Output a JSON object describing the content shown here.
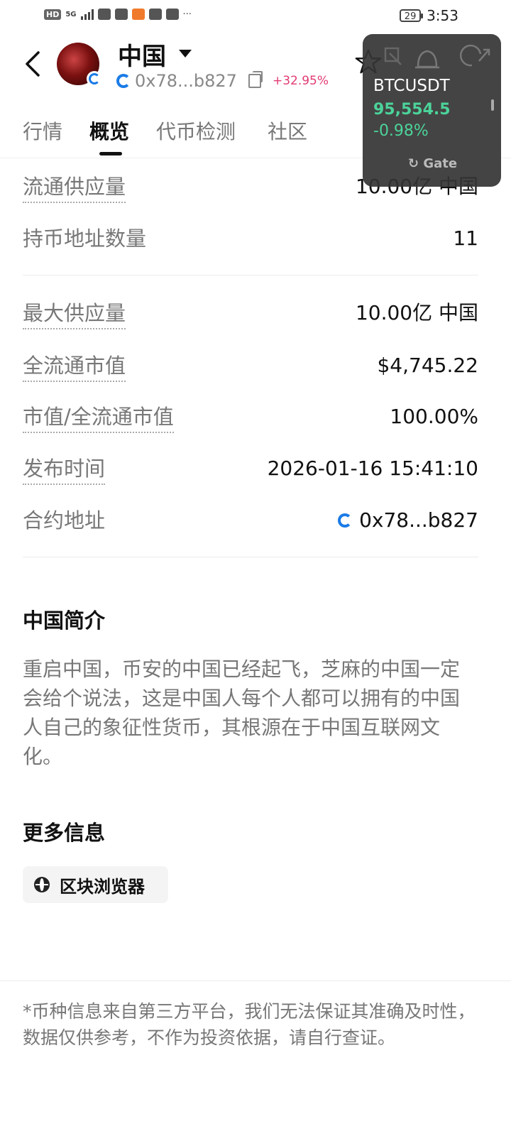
{
  "status_bar": {
    "network": "5G",
    "battery": "29",
    "time": "3:53",
    "more": "···"
  },
  "header": {
    "token_name": "中国",
    "address": "0x78...b827",
    "change_pct": "+32.95%"
  },
  "tabs": [
    "行情",
    "概览",
    "代币检测",
    "社区"
  ],
  "widget": {
    "symbol": "BTCUSDT",
    "price": "95,554.5",
    "change": "-0.98%",
    "brand": "Gate",
    "accent": "#4cd39a"
  },
  "stats": {
    "circulating_supply": {
      "label": "流通供应量",
      "value": "10.00亿 中国"
    },
    "holders": {
      "label": "持币地址数量",
      "value": "11"
    },
    "max_supply": {
      "label": "最大供应量",
      "value": "10.00亿 中国"
    },
    "fdv": {
      "label": "全流通市值",
      "value": "$4,745.22"
    },
    "mc_fdv": {
      "label": "市值/全流通市值",
      "value": "100.00%"
    },
    "launch_time": {
      "label": "发布时间",
      "value": "2026-01-16 15:41:10"
    },
    "contract": {
      "label": "合约地址",
      "value": "0x78...b827"
    }
  },
  "intro": {
    "title": "中国简介",
    "text": "重启中国，币安的中国已经起飞，芝麻的中国一定会给个说法，这是中国人每个人都可以拥有的中国人自己的象征性货币，其根源在于中国互联网文化。"
  },
  "more_info": {
    "title": "更多信息",
    "explorer_label": "区块浏览器"
  },
  "disclaimer": "*币种信息来自第三方平台，我们无法保证其准确及时性，数据仅供参考，不作为投资依据，请自行查证。"
}
